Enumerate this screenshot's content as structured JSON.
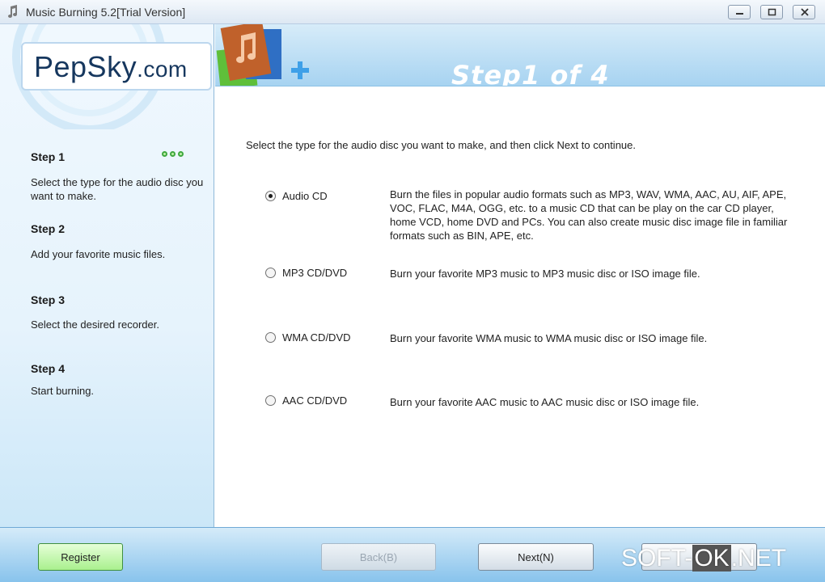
{
  "window": {
    "title": "Music Burning 5.2[Trial Version]"
  },
  "logo": {
    "name": "PepSky",
    "suffix": ".com"
  },
  "banner": {
    "step_label": "Step1 of 4"
  },
  "sidebar": {
    "steps": [
      {
        "title": "Step 1",
        "desc": "Select the type for the audio disc you want to make."
      },
      {
        "title": "Step 2",
        "desc": "Add your favorite music files."
      },
      {
        "title": "Step 3",
        "desc": "Select the desired recorder."
      },
      {
        "title": "Step 4",
        "desc": "Start burning."
      }
    ]
  },
  "main": {
    "instruction": "Select the type for the audio disc you want to make, and then click Next to continue.",
    "options": [
      {
        "label": "Audio CD",
        "checked": true,
        "desc": "Burn the files in popular audio formats such as MP3, WAV, WMA, AAC, AU, AIF, APE, VOC, FLAC, M4A, OGG, etc. to a music CD that can be play on the car CD player, home VCD, home DVD and PCs. You can also create music disc image file in familiar formats such as BIN, APE, etc."
      },
      {
        "label": "MP3 CD/DVD",
        "checked": false,
        "desc": "Burn your favorite MP3 music to MP3 music disc or ISO image file."
      },
      {
        "label": "WMA CD/DVD",
        "checked": false,
        "desc": "Burn your favorite WMA music to WMA music disc or ISO image file."
      },
      {
        "label": "AAC CD/DVD",
        "checked": false,
        "desc": "Burn your favorite AAC music to AAC music disc or ISO image file."
      }
    ]
  },
  "buttons": {
    "register": "Register",
    "back": "Back(B)",
    "next": "Next(N)"
  },
  "watermark": {
    "left": "SOFT-",
    "mid": "OK",
    "right": ".NET"
  },
  "colors": {
    "accent_blue": "#a7d3f1",
    "register_green": "#a9f08e",
    "step_dots": "#3fa83f"
  }
}
